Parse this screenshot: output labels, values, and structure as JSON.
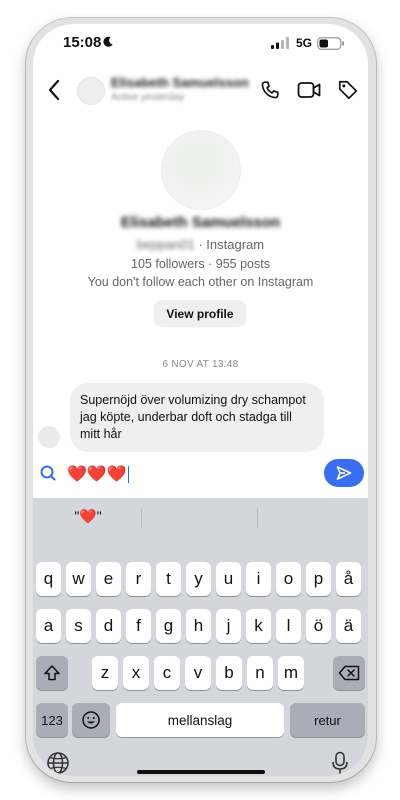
{
  "status_bar": {
    "time": "15:08",
    "network": "5G"
  },
  "header": {
    "name": "Elisabeth Samuelsson",
    "subtitle": "Active yesterday"
  },
  "profile": {
    "name": "Elisabeth Samuelsson",
    "handle": "beppan01",
    "handle_suffix": " · Instagram",
    "stats": "105 followers · 955 posts",
    "follow_status": "You don't follow each other on Instagram",
    "view_profile_label": "View profile"
  },
  "conversation": {
    "date_stamp": "6 NOV AT 13:48",
    "message_text": "Supernöjd över volumizing dry schampot jag köpte, underbar doft och stadga till mitt hår"
  },
  "composer": {
    "input_value": "❤️❤️❤️"
  },
  "keyboard": {
    "suggestion_1": "\"❤️\"",
    "row1": [
      "q",
      "w",
      "e",
      "r",
      "t",
      "y",
      "u",
      "i",
      "o",
      "p",
      "å"
    ],
    "row2": [
      "a",
      "s",
      "d",
      "f",
      "g",
      "h",
      "j",
      "k",
      "l",
      "ö",
      "ä"
    ],
    "row3": [
      "z",
      "x",
      "c",
      "v",
      "b",
      "n",
      "m"
    ],
    "numbers_label": "123",
    "space_label": "mellanslag",
    "return_label": "retur"
  },
  "colors": {
    "accent": "#3a6ef2",
    "keyboard_bg": "#d4d6dc"
  }
}
